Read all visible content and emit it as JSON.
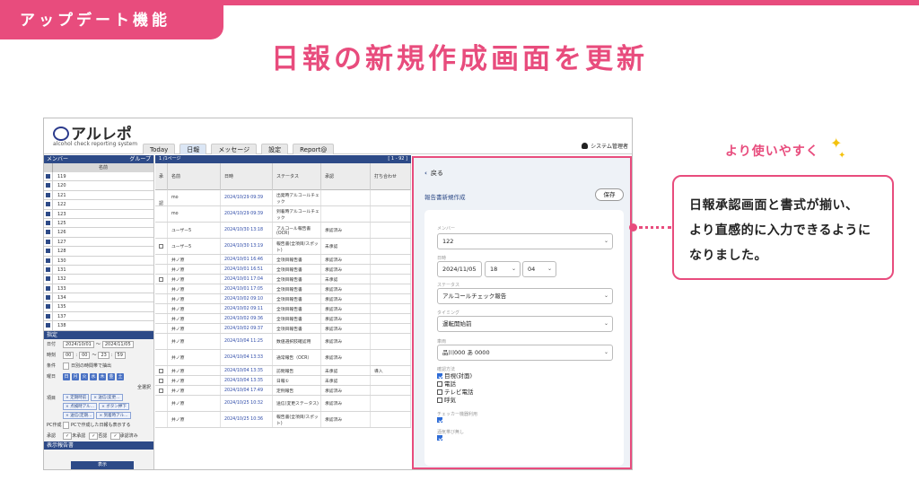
{
  "badge": "アップデート機能",
  "headline": "日報の新規作成画面を更新",
  "app": {
    "logo": "アルレポ",
    "logo_sub": "alcohol check reporting system",
    "tabs": [
      "Today",
      "日報",
      "メッセージ",
      "設定",
      "Report@"
    ],
    "user": "システム管理者"
  },
  "left": {
    "header": "メンバー",
    "header_right": "グループ",
    "col_name": "名前",
    "members": [
      "119",
      "120",
      "121",
      "122",
      "123",
      "125",
      "126",
      "127",
      "128",
      "130",
      "131",
      "132",
      "133",
      "134",
      "135",
      "137",
      "138"
    ],
    "filter_header": "指定",
    "date_label": "日付",
    "date_from": "2024/10/01",
    "date_sep": "〜",
    "date_to": "2024/11/05",
    "time_label": "時刻",
    "time_h1": "00",
    "time_m1": "00",
    "time_sep": "〜",
    "time_h2": "23",
    "time_m2": "59",
    "cond_label": "条件",
    "cond_text": "日別の時間帯で抽出",
    "dow_label": "曜日",
    "days": [
      "日",
      "月",
      "火",
      "水",
      "木",
      "金",
      "土"
    ],
    "select_all": "全選択",
    "type_label": "項目",
    "chips": [
      "定期時前",
      "送信(変更…",
      "点検時アル…",
      "ボタン押下",
      "送信(定期…",
      "到着時アル…"
    ],
    "pc_label": "PC作成",
    "pc_text": "PCで作成した日報も表示する",
    "approve_label": "承認",
    "approve_opts": [
      "未承認",
      "否認",
      "承認済み"
    ],
    "display_label": "表示報告書",
    "show_button": "表示"
  },
  "table": {
    "pager": "1 /1ページ",
    "pager_right": "[ 1 - 92 ]",
    "headers": [
      "承認",
      "名前",
      "日時",
      "ステータス",
      "承認"
    ],
    "extra_header": "打ち合わせ",
    "rows": [
      {
        "name": "mo",
        "date": "2024/10/29 09:39",
        "status": "出発時アルコールチェック",
        "approve": "",
        "check": false
      },
      {
        "name": "mo",
        "date": "2024/10/29 09:39",
        "status": "到着時アルコールチェック",
        "approve": "",
        "check": false
      },
      {
        "name": "ユーザー5",
        "date": "2024/10/30 13:18",
        "status": "アルコール報告書(OCR)",
        "approve": "承認済み",
        "check": false
      },
      {
        "name": "ユーザー5",
        "date": "2024/10/30 13:19",
        "status": "報告書(全項目/スポット)",
        "approve": "未承認",
        "check": true
      },
      {
        "name": "井ノ原",
        "date": "2024/10/01 16:46",
        "status": "全項目報告書",
        "approve": "承認済み",
        "check": false
      },
      {
        "name": "井ノ原",
        "date": "2024/10/01 16:51",
        "status": "全項目報告書",
        "approve": "承認済み",
        "check": false
      },
      {
        "name": "井ノ原",
        "date": "2024/10/01 17:04",
        "status": "全項目報告書",
        "approve": "未承認",
        "check": true
      },
      {
        "name": "井ノ原",
        "date": "2024/10/01 17:05",
        "status": "全項目報告書",
        "approve": "承認済み",
        "check": false
      },
      {
        "name": "井ノ原",
        "date": "2024/10/02 09:10",
        "status": "全項目報告書",
        "approve": "承認済み",
        "check": false
      },
      {
        "name": "井ノ原",
        "date": "2024/10/02 09:11",
        "status": "全項目報告書",
        "approve": "承認済み",
        "check": false
      },
      {
        "name": "井ノ原",
        "date": "2024/10/02 09:36",
        "status": "全項目報告書",
        "approve": "承認済み",
        "check": false
      },
      {
        "name": "井ノ原",
        "date": "2024/10/02 09:37",
        "status": "全項目報告書",
        "approve": "承認済み",
        "check": false
      },
      {
        "name": "井ノ原",
        "date": "2024/10/04 11:25",
        "status": "数値選択肢確認用",
        "approve": "承認済み",
        "check": false
      },
      {
        "name": "井ノ原",
        "date": "2024/10/04 13:33",
        "status": "通常報告（OCR）",
        "approve": "承認済み",
        "check": false
      },
      {
        "name": "井ノ原",
        "date": "2024/10/04 13:35",
        "status": "訪問報告",
        "approve": "未承認",
        "check": true
      },
      {
        "name": "井ノ原",
        "date": "2024/10/04 13:35",
        "status": "日報①",
        "approve": "未承認",
        "check": true
      },
      {
        "name": "井ノ原",
        "date": "2024/10/04 17:49",
        "status": "定例報告",
        "approve": "承認済み",
        "check": true
      },
      {
        "name": "井ノ原",
        "date": "2024/10/25 10:32",
        "status": "送信(変更ステータス)",
        "approve": "承認済み",
        "check": false
      },
      {
        "name": "井ノ原",
        "date": "2024/10/25 10:36",
        "status": "報告書(全項目/スポット)",
        "approve": "承認済み",
        "check": false
      }
    ],
    "extra_cell": "導入"
  },
  "form": {
    "back": "戻る",
    "title": "報告書新規作成",
    "save": "保存",
    "member_label": "メンバー",
    "member": "122",
    "date_label": "日時",
    "date": "2024/11/05",
    "hour": "18",
    "minute": "04",
    "status_label": "ステータス",
    "status": "アルコールチェック報告",
    "timing_label": "タイミング",
    "timing": "運転開始前",
    "vehicle_label": "車両",
    "vehicle": "品川000 あ 0000",
    "method_label": "確認方法",
    "methods": [
      {
        "label": "目視(対面)",
        "on": true
      },
      {
        "label": "電話",
        "on": false
      },
      {
        "label": "テレビ電話",
        "on": false
      },
      {
        "label": "呼気",
        "on": false
      }
    ],
    "checker_label": "チェッカー機器利用",
    "drink_label": "酒気帯び無し"
  },
  "callout": {
    "title": "より使いやすく",
    "lines": [
      "日報承認画面と書式が揃い、",
      "より直感的に入力できるように",
      "なりました。"
    ]
  },
  "colors": {
    "accent": "#e84c7d",
    "navy": "#2d4a87",
    "sparkle": "#f4c20d"
  }
}
